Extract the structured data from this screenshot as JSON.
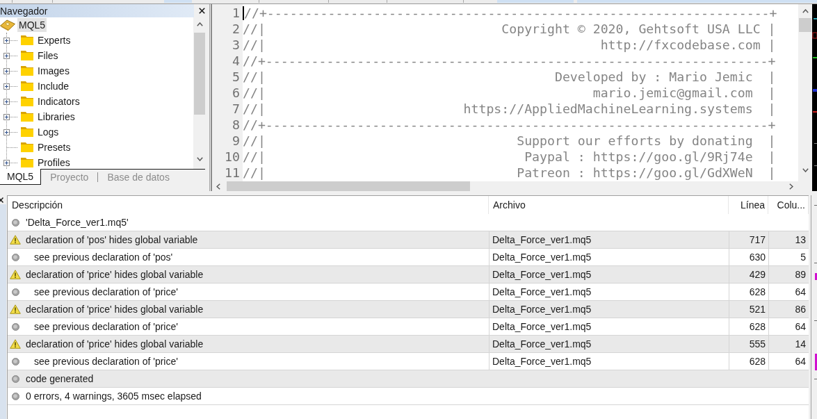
{
  "navigator": {
    "title": "Navegador",
    "tree": {
      "label": "MQL5",
      "selected": true,
      "children": [
        {
          "label": "Experts",
          "selected": false,
          "expandable": true
        },
        {
          "label": "Files",
          "selected": false,
          "expandable": true
        },
        {
          "label": "Images",
          "selected": false,
          "expandable": true
        },
        {
          "label": "Include",
          "selected": false,
          "expandable": true
        },
        {
          "label": "Indicators",
          "selected": false,
          "expandable": true
        },
        {
          "label": "Libraries",
          "selected": false,
          "expandable": true
        },
        {
          "label": "Logs",
          "selected": false,
          "expandable": true
        },
        {
          "label": "Presets",
          "selected": false,
          "expandable": false
        },
        {
          "label": "Profiles",
          "selected": false,
          "expandable": true
        }
      ]
    },
    "tabs": [
      {
        "label": "MQL5",
        "selected": true
      },
      {
        "label": "Proyecto",
        "selected": false
      },
      {
        "label": "Base de datos",
        "selected": false
      }
    ]
  },
  "editor": {
    "lines": [
      {
        "number": "1",
        "text": "//+------------------------------------------------------------------+",
        "caret": true
      },
      {
        "number": "2",
        "text": "//|                               Copyright © 2020, Gehtsoft USA LLC |",
        "caret": false
      },
      {
        "number": "3",
        "text": "//|                                            http://fxcodebase.com |",
        "caret": false
      },
      {
        "number": "4",
        "text": "//+------------------------------------------------------------------+",
        "caret": false
      },
      {
        "number": "5",
        "text": "//|                                      Developed by : Mario Jemic  |",
        "caret": false
      },
      {
        "number": "6",
        "text": "//|                                           mario.jemic@gmail.com  |",
        "caret": false
      },
      {
        "number": "7",
        "text": "//|                          https://AppliedMachineLearning.systems  |",
        "caret": false
      },
      {
        "number": "8",
        "text": "//+------------------------------------------------------------------+",
        "caret": false
      },
      {
        "number": "9",
        "text": "//|                                 Support our efforts by donating  |",
        "caret": false
      },
      {
        "number": "10",
        "text": "//|                                  Paypal : https://goo.gl/9Rj74e  |",
        "caret": false
      },
      {
        "number": "11",
        "text": "//|                                 Patreon : https://goo.gl/GdXWeN  |",
        "caret": false
      }
    ]
  },
  "toolbox": {
    "columns": [
      "Descripción",
      "Archivo",
      "Línea",
      "Colu..."
    ],
    "messages": [
      {
        "kind": "info",
        "description": "'Delta_Force_ver1.mq5'"
      },
      {
        "kind": "warning",
        "description": "declaration of 'pos' hides global variable",
        "file": "Delta_Force_ver1.mq5",
        "line": "717",
        "column": "13",
        "children": [
          {
            "kind": "info",
            "description": "see previous declaration of 'pos'",
            "file": "Delta_Force_ver1.mq5",
            "line": "630",
            "column": "5"
          }
        ]
      },
      {
        "kind": "warning",
        "description": "declaration of 'price' hides global variable",
        "file": "Delta_Force_ver1.mq5",
        "line": "429",
        "column": "89",
        "children": [
          {
            "kind": "info",
            "description": "see previous declaration of 'price'",
            "file": "Delta_Force_ver1.mq5",
            "line": "628",
            "column": "64"
          }
        ]
      },
      {
        "kind": "warning",
        "description": "declaration of 'price' hides global variable",
        "file": "Delta_Force_ver1.mq5",
        "line": "521",
        "column": "86",
        "children": [
          {
            "kind": "info",
            "description": "see previous declaration of 'price'",
            "file": "Delta_Force_ver1.mq5",
            "line": "628",
            "column": "64"
          }
        ]
      },
      {
        "kind": "warning",
        "description": "declaration of 'price' hides global variable",
        "file": "Delta_Force_ver1.mq5",
        "line": "555",
        "column": "14",
        "children": [
          {
            "kind": "info",
            "description": "see previous declaration of 'price'",
            "file": "Delta_Force_ver1.mq5",
            "line": "628",
            "column": "64"
          }
        ]
      },
      {
        "kind": "info",
        "description": "code generated"
      },
      {
        "kind": "info",
        "description": "0 errors, 4 warnings, 3605 msec elapsed"
      }
    ]
  }
}
